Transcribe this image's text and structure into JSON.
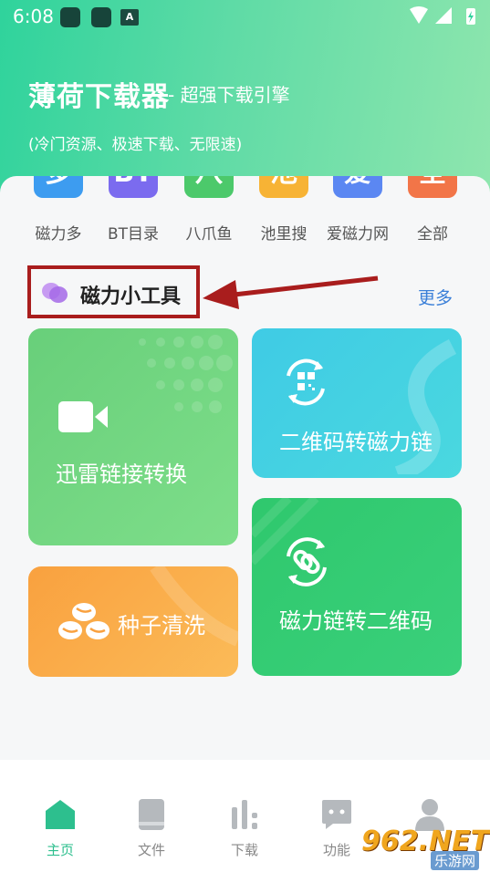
{
  "status_bar": {
    "time": "6:08",
    "app_badge": "A"
  },
  "header": {
    "title": "薄荷下载器",
    "subtitle": "- 超强下载引擎",
    "description": "(冷门资源、极速下载、无限速)"
  },
  "categories": [
    {
      "label": "磁力多",
      "glyph": "多",
      "color": "#3d9cf0"
    },
    {
      "label": "BT目录",
      "glyph": "BT",
      "color": "#7b6bef"
    },
    {
      "label": "八爪鱼",
      "glyph": "八",
      "color": "#4cc96b"
    },
    {
      "label": "池里搜",
      "glyph": "池",
      "color": "#f7b335"
    },
    {
      "label": "爱磁力网",
      "glyph": "爱",
      "color": "#5b87f2"
    },
    {
      "label": "全部",
      "glyph": "全",
      "color": "#f27548"
    }
  ],
  "section": {
    "title": "磁力小工具",
    "more": "更多"
  },
  "tools": [
    {
      "label": "迅雷链接转换",
      "icon": "video-camera-icon",
      "color": "#6ad27d"
    },
    {
      "label": "二维码转磁力链",
      "icon": "qr-convert-icon",
      "color": "#42d3e0"
    },
    {
      "label": "种子清洗",
      "icon": "seeds-icon",
      "color": "#f9ad4a"
    },
    {
      "label": "磁力链转二维码",
      "icon": "link-convert-icon",
      "color": "#33c775"
    }
  ],
  "bottom_nav": [
    {
      "label": "主页",
      "icon": "home-icon",
      "active": true
    },
    {
      "label": "文件",
      "icon": "file-icon",
      "active": false
    },
    {
      "label": "下载",
      "icon": "download-bars-icon",
      "active": false
    },
    {
      "label": "功能",
      "icon": "chat-icon",
      "active": false
    },
    {
      "label": "",
      "icon": "user-icon",
      "active": false
    }
  ],
  "watermark": {
    "main": "962.NET",
    "sub": "乐游网"
  },
  "colors": {
    "accent": "#2dbf8e",
    "link": "#3a7fd8",
    "highlight_box": "#a91d1d"
  }
}
